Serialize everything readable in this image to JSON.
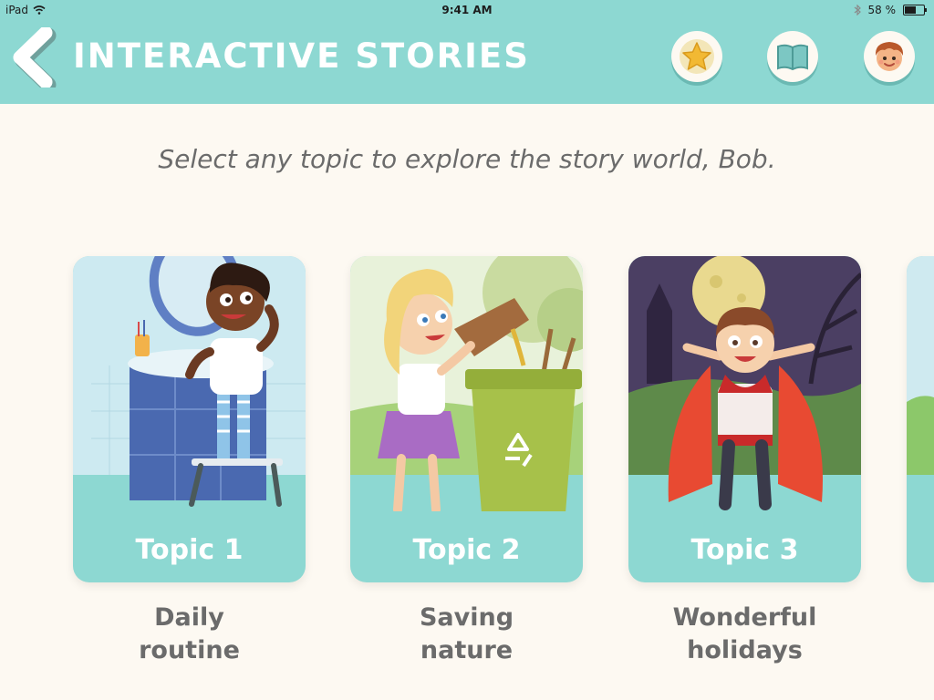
{
  "status": {
    "device": "iPad",
    "time": "9:41 AM",
    "battery": "58 %",
    "battery_level": 0.58
  },
  "header": {
    "title": "INTERACTIVE STORIES",
    "icons": [
      "back-icon",
      "star-icon",
      "book-icon",
      "avatar-icon"
    ]
  },
  "subtitle": "Select any topic to explore the story world, Bob.",
  "topics": [
    {
      "label": "Topic 1",
      "caption_line1": "Daily",
      "caption_line2": "routine"
    },
    {
      "label": "Topic 2",
      "caption_line1": "Saving",
      "caption_line2": "nature"
    },
    {
      "label": "Topic 3",
      "caption_line1": "Wonderful",
      "caption_line2": "holidays"
    }
  ],
  "colors": {
    "header": "#8dd8d2",
    "background": "#fdf9f2",
    "text": "#6b6b6b"
  }
}
